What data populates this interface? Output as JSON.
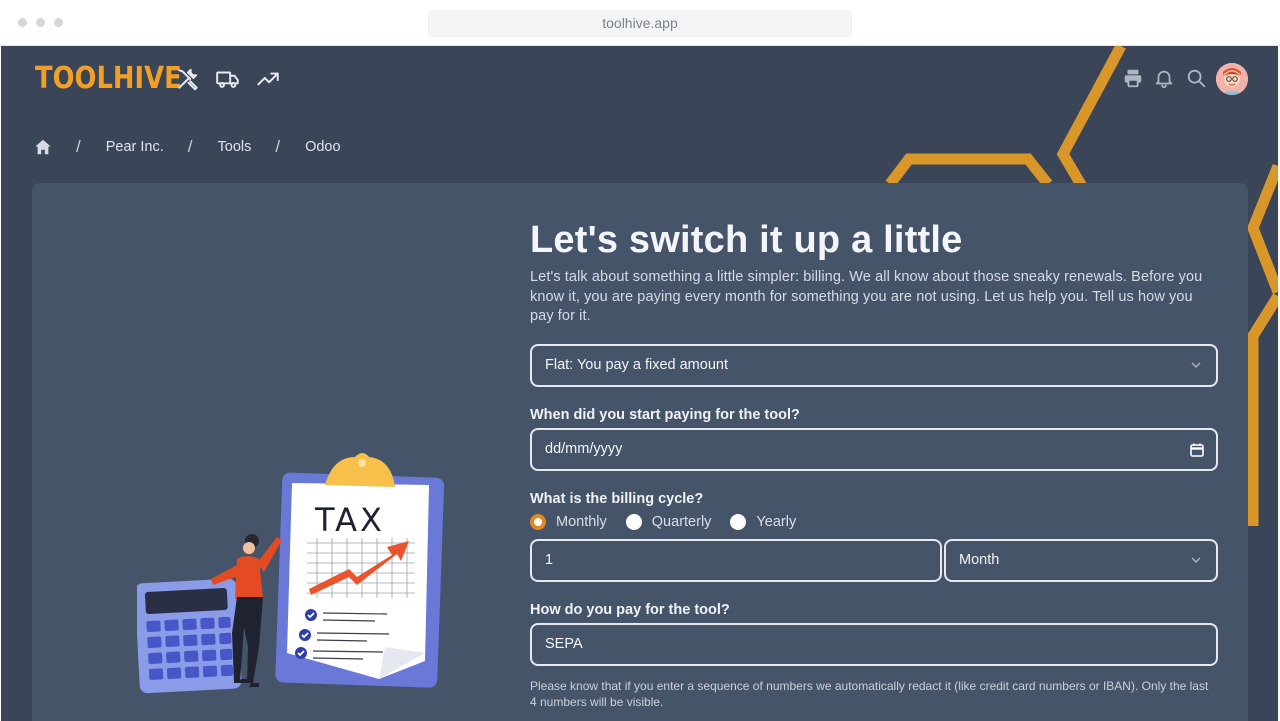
{
  "browser": {
    "url": "toolhive.app"
  },
  "app": {
    "logo": "TOOLHIVE"
  },
  "colors": {
    "accent": "#f0a026",
    "background": "#3a4557",
    "card": "#465469",
    "radio_selected": "#e08a1e"
  },
  "nav_icons": [
    "tools-icon",
    "truck-icon",
    "trending-up-icon"
  ],
  "header_icons": [
    "printer-icon",
    "bell-icon",
    "search-icon",
    "avatar"
  ],
  "breadcrumb": {
    "items": [
      "Pear Inc.",
      "Tools",
      "Odoo"
    ],
    "separator": "/"
  },
  "illustration": {
    "tax_label": "TAX"
  },
  "form": {
    "title": "Let's switch it up a little",
    "intro": "Let's talk about something a little simpler: billing. We all know about those sneaky renewals. Before you know it, you are paying every month for something you are not using. Let us help you. Tell us how you pay for it.",
    "pricing_select": "Flat: You pay a fixed amount",
    "start_label": "When did you start paying for the tool?",
    "start_placeholder": "dd/mm/yyyy",
    "cycle_label": "What is the billing cycle?",
    "cycle_options": [
      "Monthly",
      "Quarterly",
      "Yearly"
    ],
    "cycle_selected": "Monthly",
    "cycle_amount": "1",
    "cycle_unit": "Month",
    "payment_label": "How do you pay for the tool?",
    "payment_value": "SEPA",
    "payment_note": "Please know that if you enter a sequence of numbers we automatically redact it (like credit card numbers or IBAN). Only the last 4 numbers will be visible."
  }
}
